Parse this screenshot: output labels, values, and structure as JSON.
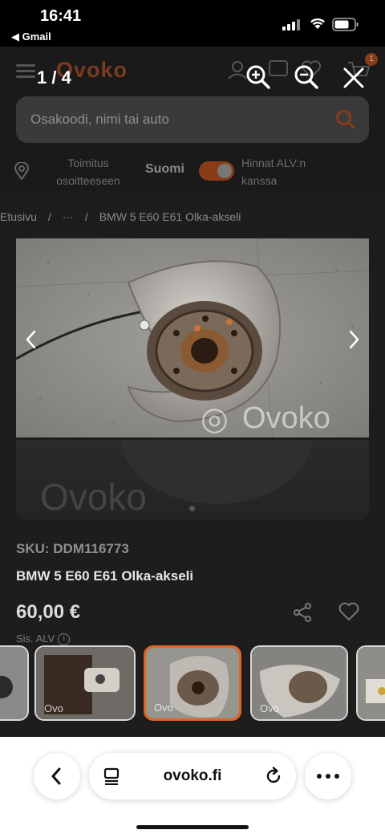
{
  "status_bar": {
    "time": "16:41",
    "back_app": "◀ Gmail"
  },
  "site": {
    "logo": "Ovoko",
    "cart_count": "1",
    "search": {
      "placeholder": "Osakoodi, nimi tai auto"
    },
    "delivery": {
      "label": "Toimitus osoitteeseen",
      "country": "Suomi",
      "vat_label": "Hinnat ALV:n kanssa"
    },
    "breadcrumb": [
      "Etusivu",
      "/",
      "···",
      "/",
      "BMW 5 E60 E61 Olka-akseli"
    ],
    "product": {
      "sku": "SKU: DDM116773",
      "title": "BMW 5 E60 E61 Olka-akseli",
      "price": "60,00 €",
      "includes": "Sis. ALV"
    },
    "watermark": "Ovoko"
  },
  "gallery": {
    "counter": "1 / 4",
    "watermark": "Ovoko",
    "thumbnail_watermark": "Ovo",
    "active_index": 2
  },
  "browser": {
    "url": "ovoko.fi"
  },
  "colors": {
    "accent": "#e2641f",
    "dim_accent": "#8a3b18"
  }
}
